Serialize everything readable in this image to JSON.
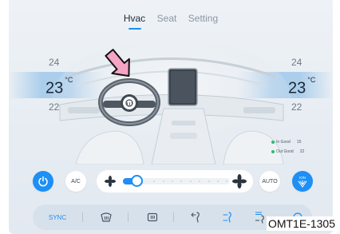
{
  "tabs": [
    {
      "label": "Hvac",
      "active": true
    },
    {
      "label": "Seat",
      "active": false
    },
    {
      "label": "Setting",
      "active": false
    }
  ],
  "left_zone": {
    "temp_up": "24",
    "temp_current": "23",
    "unit": "°C",
    "temp_down": "22"
  },
  "right_zone": {
    "temp_up": "24",
    "temp_current": "23",
    "unit": "°C",
    "temp_down": "22"
  },
  "air_quality": {
    "in_label": "In Good",
    "in_value": "15",
    "out_label": "Out Good",
    "out_value": "22",
    "status_color": "#2bbd6e"
  },
  "controls": {
    "power_icon": "power-icon",
    "ac_label": "A/C",
    "auto_label": "AUTO",
    "ion_label": "ION",
    "fan_level": 0.13,
    "accent_color": "#1d8ff5"
  },
  "mode_bar": {
    "sync_label": "SYNC",
    "icons": [
      "front-defrost-icon",
      "rear-defrost-icon",
      "face-vent-icon",
      "face-feet-vent-icon",
      "feet-vent-icon",
      "recirculation-icon"
    ]
  },
  "watermark": "OMT1E-1305"
}
